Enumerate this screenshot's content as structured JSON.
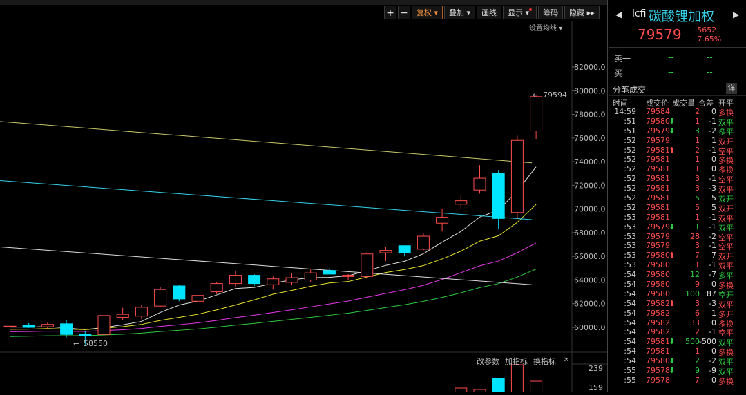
{
  "topbar": {
    "items": [
      "",
      "",
      "",
      "",
      "",
      "",
      "",
      "",
      ""
    ]
  },
  "toolbar": {
    "plus": "+",
    "minus": "−",
    "fuquan": "复权",
    "diejia": "叠加",
    "huaxian": "画线",
    "xianshi": "显示",
    "chouma": "筹码",
    "yincang": "隐藏"
  },
  "ma_setting": "设置均线",
  "y_axis": [
    "82000.0",
    "80000.0",
    "78000.0",
    "76000.0",
    "74000.0",
    "72000.0",
    "70000.0",
    "68000.0",
    "66000.0",
    "64000.0",
    "62000.0",
    "60000.0"
  ],
  "annotations": {
    "high": "79594",
    "low": "58550"
  },
  "sub": {
    "gaicanshu": "改参数",
    "jiazhibiao": "加指标",
    "huanzhibiao": "换指标",
    "close": "✕",
    "y_top": "239",
    "y_mid": "159"
  },
  "colors": {
    "up": "#ff4d4d",
    "down": "#00e5ff",
    "ma5": "#e0e0e0",
    "ma10": "#e8e32a",
    "ma20": "#e838e8",
    "ma30": "#2ecc40",
    "ma60": "#35d0e8"
  },
  "chart_data": {
    "type": "candlestick",
    "ylim": [
      58550,
      82000
    ],
    "candles": [
      {
        "o": 60050,
        "h": 60250,
        "l": 59850,
        "c": 60100
      },
      {
        "o": 60150,
        "h": 60350,
        "l": 59950,
        "c": 60000
      },
      {
        "o": 60050,
        "h": 60450,
        "l": 59900,
        "c": 60250
      },
      {
        "o": 60300,
        "h": 60600,
        "l": 59150,
        "c": 59400
      },
      {
        "o": 59400,
        "h": 59700,
        "l": 58550,
        "c": 59300
      },
      {
        "o": 59400,
        "h": 61300,
        "l": 59300,
        "c": 61000
      },
      {
        "o": 60850,
        "h": 61650,
        "l": 60600,
        "c": 61100
      },
      {
        "o": 60950,
        "h": 61900,
        "l": 60700,
        "c": 61700
      },
      {
        "o": 61800,
        "h": 63400,
        "l": 61700,
        "c": 63200
      },
      {
        "o": 63500,
        "h": 63600,
        "l": 62200,
        "c": 62400
      },
      {
        "o": 62200,
        "h": 62900,
        "l": 61900,
        "c": 62700
      },
      {
        "o": 63000,
        "h": 63800,
        "l": 62800,
        "c": 63700
      },
      {
        "o": 63700,
        "h": 64800,
        "l": 63400,
        "c": 64400
      },
      {
        "o": 64400,
        "h": 64500,
        "l": 63500,
        "c": 63700
      },
      {
        "o": 63600,
        "h": 64300,
        "l": 63200,
        "c": 64100
      },
      {
        "o": 63800,
        "h": 64600,
        "l": 63600,
        "c": 64200
      },
      {
        "o": 64000,
        "h": 64900,
        "l": 63800,
        "c": 64600
      },
      {
        "o": 64800,
        "h": 65000,
        "l": 64500,
        "c": 64500
      },
      {
        "o": 64300,
        "h": 64500,
        "l": 64000,
        "c": 64400
      },
      {
        "o": 64300,
        "h": 66400,
        "l": 64200,
        "c": 66200
      },
      {
        "o": 66300,
        "h": 66800,
        "l": 65600,
        "c": 66500
      },
      {
        "o": 66900,
        "h": 66900,
        "l": 66000,
        "c": 66300
      },
      {
        "o": 66600,
        "h": 68000,
        "l": 66500,
        "c": 67700
      },
      {
        "o": 68800,
        "h": 70000,
        "l": 68100,
        "c": 69300
      },
      {
        "o": 70400,
        "h": 71200,
        "l": 70000,
        "c": 70700
      },
      {
        "o": 71600,
        "h": 73700,
        "l": 71300,
        "c": 72600
      },
      {
        "o": 73000,
        "h": 73300,
        "l": 68300,
        "c": 69200
      },
      {
        "o": 69700,
        "h": 76200,
        "l": 69200,
        "c": 75800
      },
      {
        "o": 76600,
        "h": 79594,
        "l": 75900,
        "c": 79500
      }
    ]
  },
  "panel": {
    "code": "lcfi",
    "name": "碳酸锂加权",
    "arrow_left": "◀",
    "arrow_right": "▶",
    "price": "79579",
    "change": "+5652",
    "change_pct": "+7.65%",
    "orderbook": [
      {
        "label": "卖一",
        "price": "--",
        "vol": "--"
      },
      {
        "label": "买一",
        "price": "--",
        "vol": "--"
      }
    ],
    "tick_title": "分笔成交",
    "tick_detail": "详",
    "tick_headers": [
      "时间",
      "成交价",
      "成交量",
      "合差",
      "开平"
    ],
    "ticks": [
      {
        "t": "14:59",
        "p": "79584",
        "a": "",
        "v": "2",
        "o": "0",
        "k": "多换",
        "vc": "red",
        "kc": "red"
      },
      {
        "t": ":51",
        "p": "79580",
        "a": "⬇",
        "v": "1",
        "o": "-1",
        "k": "双平",
        "vc": "red",
        "kc": "green"
      },
      {
        "t": ":51",
        "p": "79579",
        "a": "⬇",
        "v": "3",
        "o": "-2",
        "k": "多平",
        "vc": "green",
        "kc": "green"
      },
      {
        "t": ":52",
        "p": "79579",
        "a": "",
        "v": "1",
        "o": "1",
        "k": "双开",
        "vc": "red",
        "kc": "red"
      },
      {
        "t": ":52",
        "p": "79581",
        "a": "⬆",
        "v": "2",
        "o": "-1",
        "k": "空平",
        "vc": "red",
        "kc": "red"
      },
      {
        "t": ":52",
        "p": "79581",
        "a": "",
        "v": "1",
        "o": "0",
        "k": "多换",
        "vc": "red",
        "kc": "red"
      },
      {
        "t": ":52",
        "p": "79581",
        "a": "",
        "v": "1",
        "o": "0",
        "k": "多换",
        "vc": "red",
        "kc": "red"
      },
      {
        "t": ":52",
        "p": "79581",
        "a": "",
        "v": "3",
        "o": "-1",
        "k": "空平",
        "vc": "red",
        "kc": "red"
      },
      {
        "t": ":52",
        "p": "79581",
        "a": "",
        "v": "3",
        "o": "-3",
        "k": "双平",
        "vc": "red",
        "kc": "red"
      },
      {
        "t": ":52",
        "p": "79581",
        "a": "",
        "v": "5",
        "o": "5",
        "k": "双开",
        "vc": "green",
        "kc": "green"
      },
      {
        "t": ":52",
        "p": "79581",
        "a": "",
        "v": "5",
        "o": "5",
        "k": "双开",
        "vc": "red",
        "kc": "red"
      },
      {
        "t": ":53",
        "p": "79581",
        "a": "",
        "v": "1",
        "o": "-1",
        "k": "双平",
        "vc": "red",
        "kc": "red"
      },
      {
        "t": ":53",
        "p": "79579",
        "a": "⬇",
        "v": "1",
        "o": "-1",
        "k": "双平",
        "vc": "green",
        "kc": "green"
      },
      {
        "t": ":53",
        "p": "79579",
        "a": "",
        "v": "28",
        "o": "-2",
        "k": "空平",
        "vc": "red",
        "kc": "red"
      },
      {
        "t": ":53",
        "p": "79579",
        "a": "",
        "v": "3",
        "o": "-1",
        "k": "空平",
        "vc": "red",
        "kc": "red"
      },
      {
        "t": ":53",
        "p": "79580",
        "a": "⬆",
        "v": "7",
        "o": "7",
        "k": "双开",
        "vc": "red",
        "kc": "red"
      },
      {
        "t": ":53",
        "p": "79580",
        "a": "",
        "v": "1",
        "o": "-1",
        "k": "双平",
        "vc": "red",
        "kc": "red"
      },
      {
        "t": ":54",
        "p": "79580",
        "a": "",
        "v": "12",
        "o": "-7",
        "k": "多平",
        "vc": "green",
        "kc": "green"
      },
      {
        "t": ":54",
        "p": "79580",
        "a": "",
        "v": "9",
        "o": "0",
        "k": "多换",
        "vc": "red",
        "kc": "red"
      },
      {
        "t": ":54",
        "p": "79580",
        "a": "",
        "v": "100",
        "o": "87",
        "k": "空开",
        "vc": "green",
        "kc": "green"
      },
      {
        "t": ":54",
        "p": "79582",
        "a": "⬆",
        "v": "3",
        "o": "-3",
        "k": "双平",
        "vc": "red",
        "kc": "red"
      },
      {
        "t": ":54",
        "p": "79582",
        "a": "",
        "v": "6",
        "o": "1",
        "k": "多开",
        "vc": "red",
        "kc": "red"
      },
      {
        "t": ":54",
        "p": "79582",
        "a": "",
        "v": "33",
        "o": "0",
        "k": "多换",
        "vc": "red",
        "kc": "red"
      },
      {
        "t": ":54",
        "p": "79582",
        "a": "",
        "v": "2",
        "o": "-1",
        "k": "空平",
        "vc": "red",
        "kc": "red"
      },
      {
        "t": ":54",
        "p": "79581",
        "a": "⬇",
        "v": "500",
        "o": "-500",
        "k": "双平",
        "vc": "green",
        "kc": "green"
      },
      {
        "t": ":54",
        "p": "79581",
        "a": "",
        "v": "1",
        "o": "0",
        "k": "多换",
        "vc": "red",
        "kc": "red"
      },
      {
        "t": ":54",
        "p": "79580",
        "a": "⬇",
        "v": "2",
        "o": "-2",
        "k": "双平",
        "vc": "green",
        "kc": "green"
      },
      {
        "t": ":55",
        "p": "79578",
        "a": "⬇",
        "v": "9",
        "o": "-9",
        "k": "双平",
        "vc": "green",
        "kc": "green"
      },
      {
        "t": ":55",
        "p": "79578",
        "a": "",
        "v": "7",
        "o": "0",
        "k": "多换",
        "vc": "red",
        "kc": "red"
      }
    ]
  }
}
